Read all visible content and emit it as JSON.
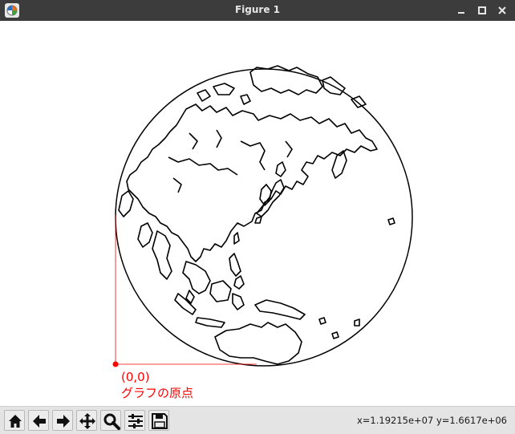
{
  "window": {
    "title": "Figure 1",
    "minimize_glyph": "–",
    "maximize_glyph": "□",
    "close_glyph": "✕"
  },
  "figure": {
    "projection": "orthographic globe",
    "annotation_coord": "(0,0)",
    "annotation_label": "グラフの原点",
    "annotation_color": "#ff0000",
    "coastline_color": "#000000"
  },
  "toolbar": {
    "buttons": [
      {
        "icon": "home-icon",
        "name": "home-button"
      },
      {
        "icon": "back-arrow-icon",
        "name": "back-button"
      },
      {
        "icon": "forward-arrow-icon",
        "name": "forward-button"
      },
      {
        "icon": "pan-move-icon",
        "name": "pan-button"
      },
      {
        "icon": "zoom-magnifier-icon",
        "name": "zoom-button"
      },
      {
        "icon": "configure-subplots-icon",
        "name": "configure-subplots-button"
      },
      {
        "icon": "save-floppy-icon",
        "name": "save-button"
      }
    ],
    "coordinates": "x=1.19215e+07  y=1.6617e+06"
  }
}
